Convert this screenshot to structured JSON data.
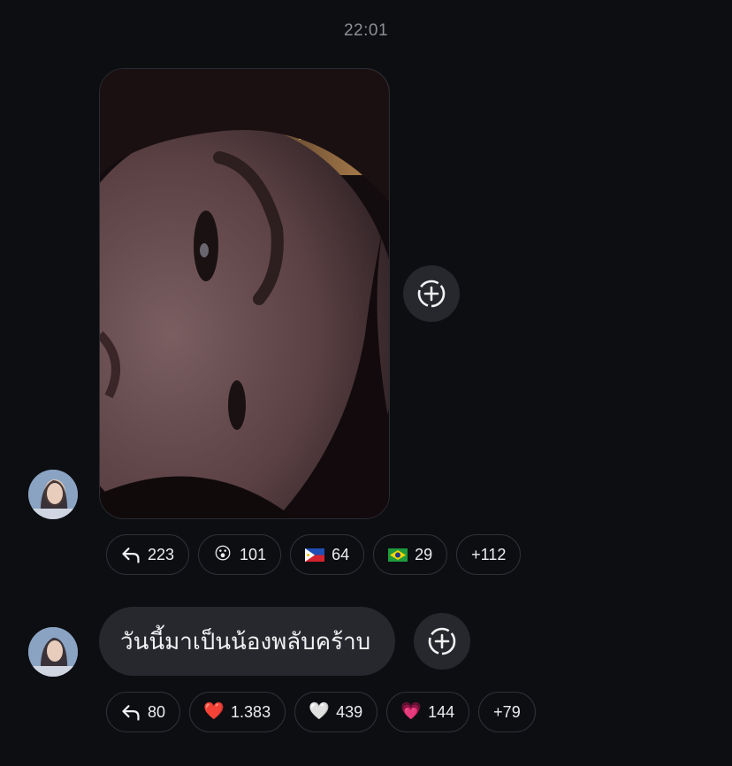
{
  "timestamp": "22:01",
  "messages": [
    {
      "type": "photo",
      "reactions": [
        {
          "icon": "reply-icon",
          "count": "223"
        },
        {
          "icon": "😮",
          "count": "101"
        },
        {
          "icon": "philippines-flag-icon",
          "count": "64"
        },
        {
          "icon": "brazil-flag-icon",
          "count": "29"
        },
        {
          "icon": "",
          "count": "+112"
        }
      ]
    },
    {
      "type": "text",
      "text": "วันนี้มาเป็นน้องพลับคร้าบ",
      "reactions": [
        {
          "icon": "reply-icon",
          "count": "80"
        },
        {
          "icon": "❤️",
          "count": "1.383"
        },
        {
          "icon": "🤍",
          "count": "439"
        },
        {
          "icon": "💗",
          "count": "144"
        },
        {
          "icon": "",
          "count": "+79"
        }
      ]
    }
  ]
}
